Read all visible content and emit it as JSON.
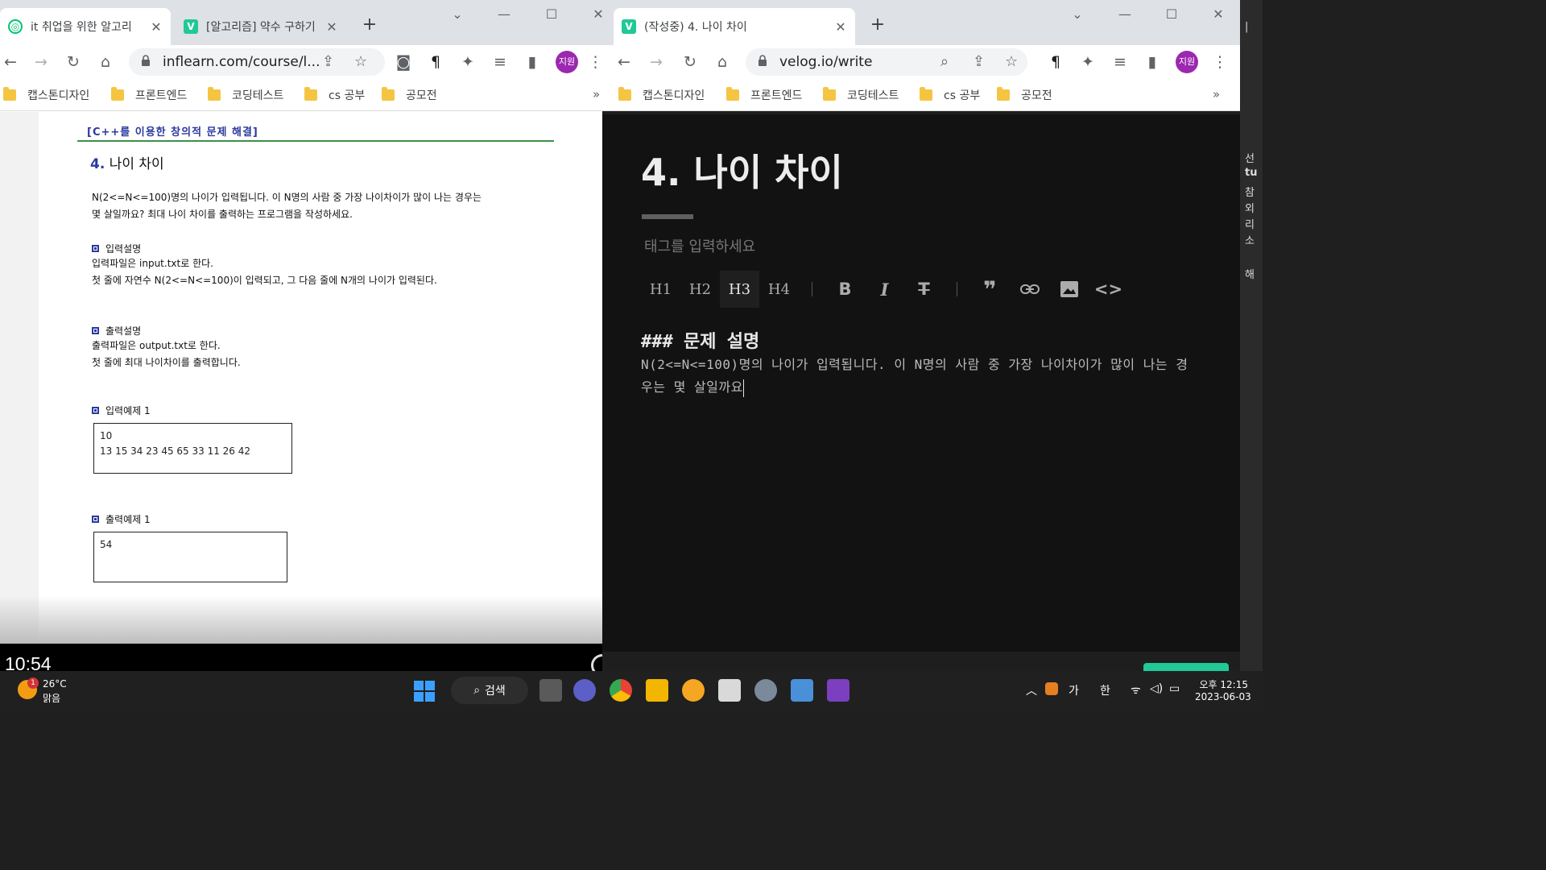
{
  "left_window": {
    "tabs": [
      {
        "label": "it 취업을 위한 알고리",
        "favicon_color": "#00c471",
        "active": true
      },
      {
        "label": "[알고리즘] 약수 구하기",
        "favicon_color": "#20c997",
        "active": false
      }
    ],
    "url": "inflearn.com/course/l...",
    "bookmarks": [
      "캡스톤디자인",
      "프론트엔드",
      "코딩테스트",
      "cs 공부",
      "공모전"
    ],
    "bookmarks_more": "»",
    "avatar": "지원",
    "pdf": {
      "header": "[C++를 이용한 창의적 문제 해결]",
      "title_num": "4.",
      "title_text": "나이 차이",
      "desc_line1": "N(2<=N<=100)명의 나이가 입력됩니다. 이 N명의 사람 중 가장 나이차이가 많이 나는 경우는",
      "desc_line2": "몇 살일까요? 최대 나이 차이를 출력하는 프로그램을 작성하세요.",
      "input_title": "입력설명",
      "input_line1": "입력파일은 input.txt로 한다.",
      "input_line2": "첫 줄에 자연수 N(2<=N<=100)이 입력되고, 그 다음 줄에 N개의 나이가 입력된다.",
      "output_title": "출력설명",
      "output_line1": "출력파일은 output.txt로 한다.",
      "output_line2": "첫 줄에 최대 나이차이를 출력합니다.",
      "example_in_title": "입력예제 1",
      "example_in_line1": "10",
      "example_in_line2": "13 15 34 23 45 65 33 11 26 42",
      "example_out_title": "출력예제 1",
      "example_out_line1": "54"
    },
    "video_time": "10:54"
  },
  "right_window": {
    "tab": {
      "label": "(작성중) 4. 나이 차이",
      "favicon_color": "#20c997"
    },
    "url": "velog.io/write",
    "bookmarks": [
      "캡스톤디자인",
      "프론트엔드",
      "코딩테스트",
      "cs 공부",
      "공모전"
    ],
    "bookmarks_more": "»",
    "avatar": "지원",
    "editor": {
      "title": "4. 나이 차이",
      "tag_placeholder": "태그를 입력하세요",
      "toolbar": [
        "H1",
        "H2",
        "H3",
        "H4"
      ],
      "active_heading": "H3",
      "md_heading": "### 문제 설명",
      "md_body": "N(2<=N<=100)명의 나이가 입력됩니다. 이 N명의 사람 중 가장 나이차이가 많이 나는 경우는 몇 살일까요"
    }
  },
  "side_strip": {
    "items": [
      "|",
      "선",
      "tu",
      "참",
      "외",
      "리",
      "소",
      "해"
    ]
  },
  "taskbar": {
    "weather_temp": "26°C",
    "weather_cond": "맑음",
    "weather_badge": "1",
    "search_label": "검색",
    "ime_lang": "가",
    "ime_mode": "한",
    "clock_time": "오후 12:15",
    "clock_date": "2023-06-03"
  }
}
